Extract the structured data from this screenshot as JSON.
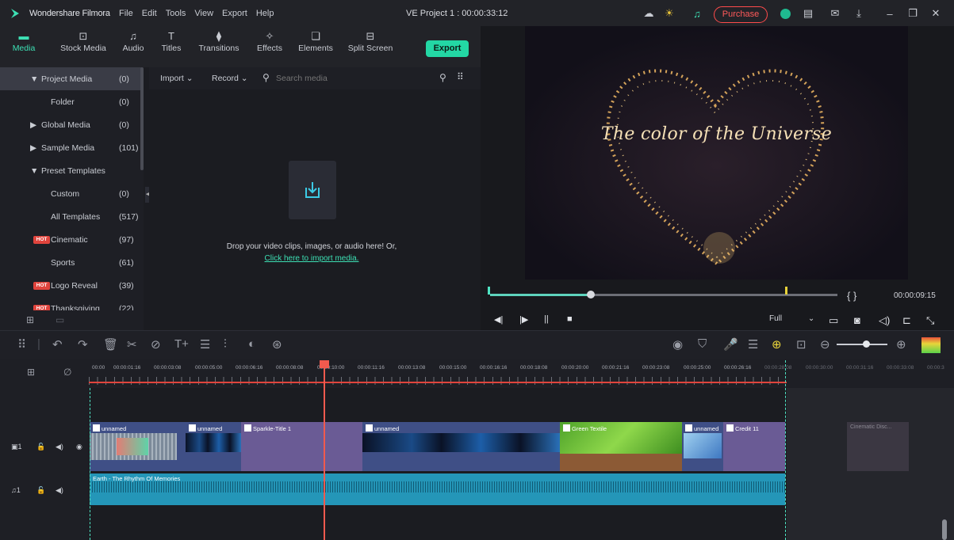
{
  "app": {
    "name": "Wondershare Filmora",
    "menus": [
      "File",
      "Edit",
      "Tools",
      "View",
      "Export",
      "Help"
    ],
    "project_title": "VE Project 1 : 00:00:33:12",
    "purchase_label": "Purchase"
  },
  "tabs": [
    {
      "label": "Media",
      "icon": "media-icon",
      "active": true
    },
    {
      "label": "Stock Media",
      "icon": "stock-media-icon"
    },
    {
      "label": "Audio",
      "icon": "audio-icon"
    },
    {
      "label": "Titles",
      "icon": "titles-icon"
    },
    {
      "label": "Transitions",
      "icon": "transitions-icon"
    },
    {
      "label": "Effects",
      "icon": "effects-icon"
    },
    {
      "label": "Elements",
      "icon": "elements-icon"
    },
    {
      "label": "Split Screen",
      "icon": "split-screen-icon"
    }
  ],
  "export_label": "Export",
  "tree": [
    {
      "label": "Project Media",
      "count": "(0)",
      "arrow": "▼",
      "selected": true
    },
    {
      "label": "Folder",
      "count": "(0)"
    },
    {
      "label": "Global Media",
      "count": "(0)",
      "arrow": "▶"
    },
    {
      "label": "Sample Media",
      "count": "(101)",
      "arrow": "▶"
    },
    {
      "label": "Preset Templates",
      "count": "",
      "arrow": "▼"
    },
    {
      "label": "Custom",
      "count": "(0)"
    },
    {
      "label": "All Templates",
      "count": "(517)"
    },
    {
      "label": "Cinematic",
      "count": "(97)",
      "hot": true
    },
    {
      "label": "Sports",
      "count": "(61)"
    },
    {
      "label": "Logo Reveal",
      "count": "(39)",
      "hot": true
    },
    {
      "label": "Thanksgiving",
      "count": "(22)",
      "hot": true
    }
  ],
  "hot_badge": "HOT",
  "media_bar": {
    "import_label": "Import",
    "record_label": "Record",
    "search_placeholder": "Search media"
  },
  "drop_text": "Drop your video clips, images, or audio here! Or,",
  "drop_link": "Click here to import media.",
  "preview": {
    "caption": "The color of the Universe",
    "timecode": "00:00:09:15",
    "braces": "{   }",
    "quality": "Full",
    "progress": 0.29
  },
  "ruler_labels": [
    "00:00",
    "00:00:01:16",
    "00:00:03:08",
    "00:00:05:00",
    "00:00:06:16",
    "00:00:08:08",
    "00:00:10:00",
    "00:00:11:16",
    "00:00:13:08",
    "00:00:15:00",
    "00:00:16:16",
    "00:00:18:08",
    "00:00:20:00",
    "00:00:21:16",
    "00:00:23:08",
    "00:00:25:00",
    "00:00:26:16",
    "00:00:28:08",
    "00:00:30:00",
    "00:00:31:16",
    "00:00:33:08",
    "00:00:3"
  ],
  "clips": {
    "c1": "unnamed",
    "c2": "unnamed",
    "c3": "Sparkle-Title 1",
    "c4": "unnamed",
    "c5": "Green Textile",
    "c6": "unnamed",
    "c7": "Credit 11",
    "ghost": "Cinematic Disc...",
    "audio": "Earth - The Rhythm Of Memories"
  },
  "tracks": {
    "video": "1",
    "audio": "1"
  },
  "colors": {
    "accent": "#23d7a4",
    "playhead": "#f15a4e",
    "purchase": "#ff4b4b"
  }
}
